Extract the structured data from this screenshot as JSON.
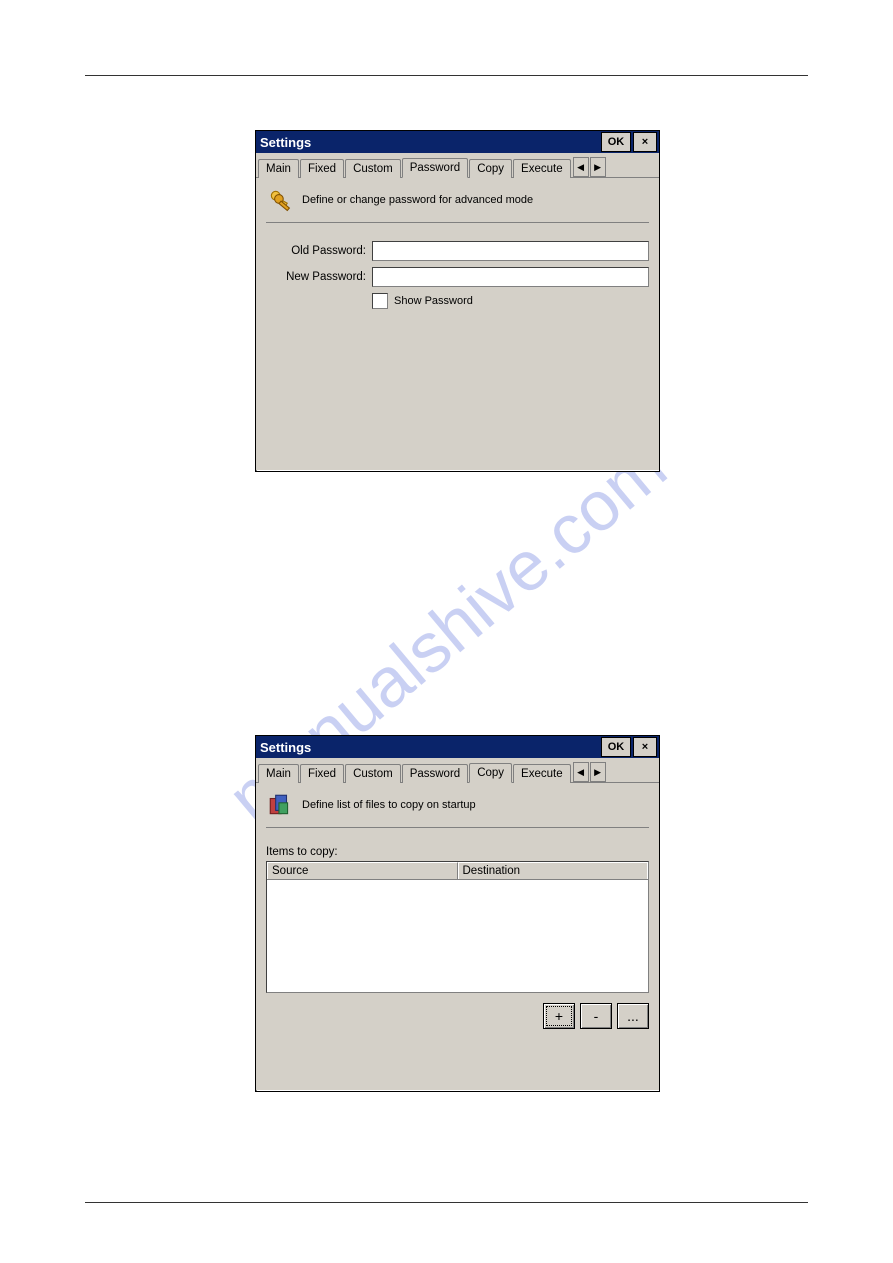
{
  "watermark": "manualshive.com",
  "window1": {
    "title": "Settings",
    "ok_label": "OK",
    "close_label": "×",
    "tabs": [
      "Main",
      "Fixed",
      "Custom",
      "Password",
      "Copy",
      "Execute"
    ],
    "active_tab_index": 3,
    "scroll_left": "◀",
    "scroll_right": "▶",
    "heading": "Define or change password for advanced mode",
    "old_password_label": "Old Password:",
    "old_password_value": "",
    "new_password_label": "New Password:",
    "new_password_value": "",
    "show_password_label": "Show Password"
  },
  "window2": {
    "title": "Settings",
    "ok_label": "OK",
    "close_label": "×",
    "tabs": [
      "Main",
      "Fixed",
      "Custom",
      "Password",
      "Copy",
      "Execute"
    ],
    "active_tab_index": 4,
    "scroll_left": "◀",
    "scroll_right": "▶",
    "heading": "Define list of files to copy on startup",
    "items_label": "Items to copy:",
    "columns": [
      "Source",
      "Destination"
    ],
    "btn_add": "+",
    "btn_remove": "-",
    "btn_more": "..."
  }
}
